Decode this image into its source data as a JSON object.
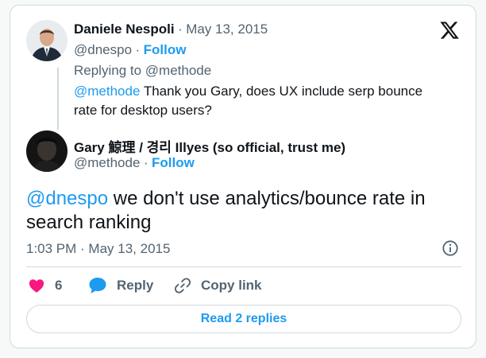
{
  "reply_tweet": {
    "author_name": "Daniele Nespoli",
    "separator": "·",
    "date": "May 13, 2015",
    "handle": "@dnespo",
    "follow_label": "Follow",
    "replying_to_label": "Replying to @methode",
    "mention": "@methode",
    "text": " Thank you Gary, does UX include serp bounce rate for desktop users?"
  },
  "main_tweet": {
    "author_name": "Gary 鯨理 / 경리 Illyes (so official, trust me)",
    "handle": "@methode",
    "follow_label": "Follow",
    "mention": "@dnespo",
    "text": " we don't use analytics/bounce rate in search ranking",
    "timestamp": "1:03 PM · May 13, 2015"
  },
  "actions": {
    "like_count": "6",
    "reply_label": "Reply",
    "copy_link_label": "Copy link"
  },
  "read_replies_label": "Read 2 replies",
  "colors": {
    "accent": "#1d9bf0",
    "like": "#f91880",
    "text": "#0f1419",
    "muted": "#536471"
  },
  "icons": [
    "x-logo-icon",
    "info-icon",
    "heart-icon",
    "reply-bubble-icon",
    "link-icon"
  ]
}
